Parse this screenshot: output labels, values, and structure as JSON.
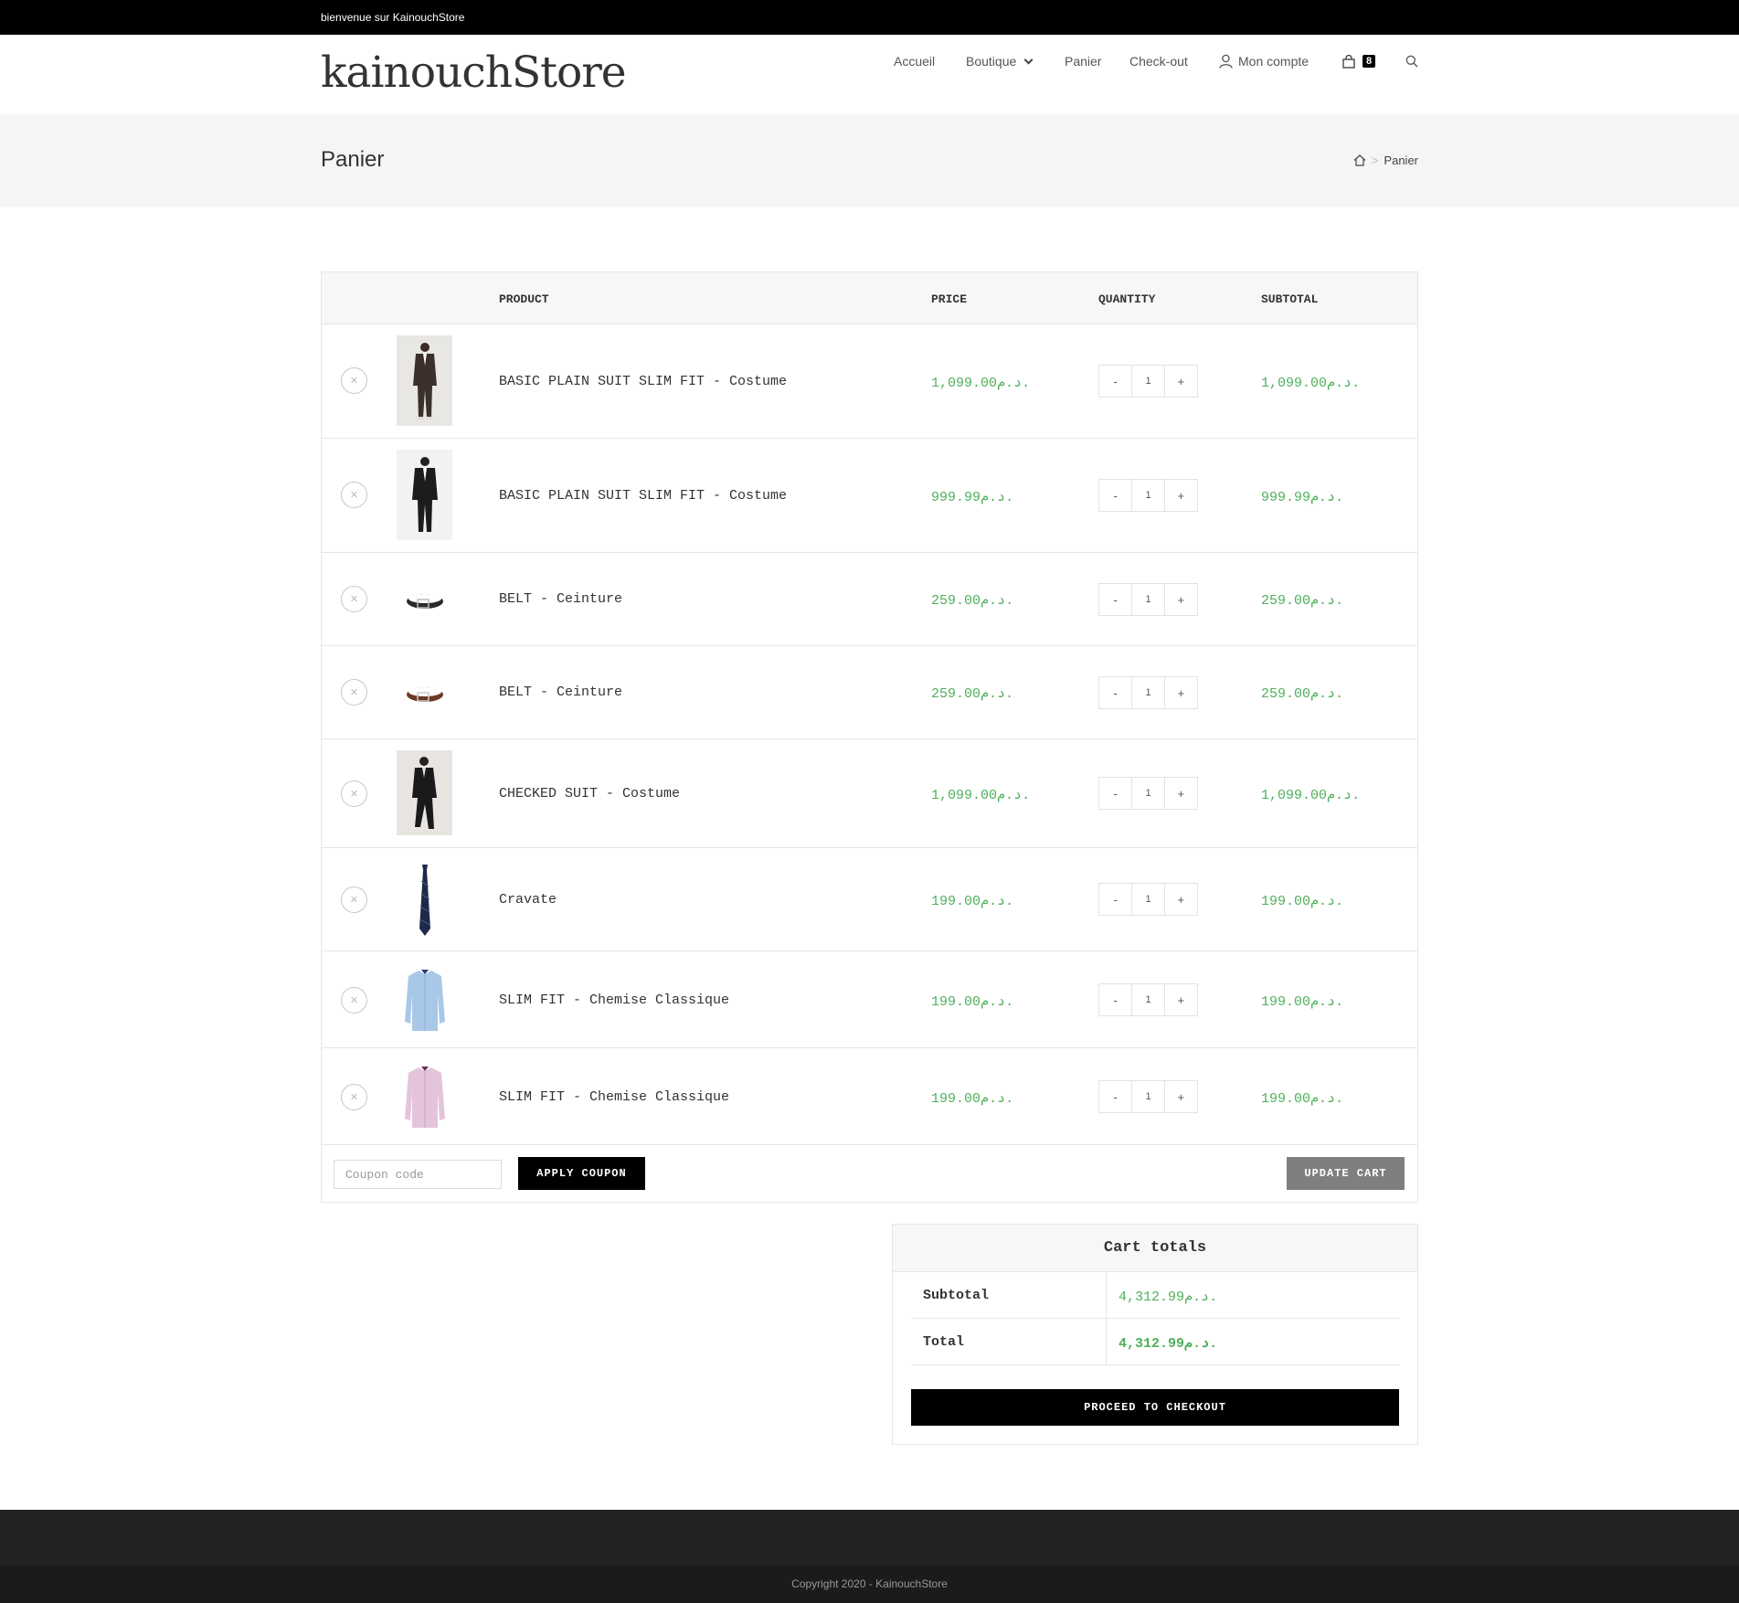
{
  "topbar": {
    "text": "bienvenue sur KainouchStore"
  },
  "header": {
    "logo": "kainouchStore",
    "nav": {
      "home": "Accueil",
      "shop": "Boutique",
      "cart": "Panier",
      "checkout": "Check-out",
      "account": "Mon compte",
      "cart_count": "8"
    }
  },
  "page": {
    "title": "Panier",
    "breadcrumb_current": "Panier"
  },
  "table": {
    "headers": {
      "product": "PRODUCT",
      "price": "PRICE",
      "quantity": "QUANTITY",
      "subtotal": "SUBTOTAL"
    },
    "rows": [
      {
        "name": "BASIC PLAIN SUIT SLIM FIT - Costume",
        "price": "1,099.00د.م.",
        "qty": "1",
        "subtotal": "1,099.00د.م.",
        "img": "suit-brown-icon"
      },
      {
        "name": "BASIC PLAIN SUIT SLIM FIT - Costume",
        "price": "999.99د.م.",
        "qty": "1",
        "subtotal": "999.99د.م.",
        "img": "suit-black-icon"
      },
      {
        "name": "BELT - Ceinture",
        "price": "259.00د.م.",
        "qty": "1",
        "subtotal": "259.00د.م.",
        "img": "belt-black-icon"
      },
      {
        "name": "BELT - Ceinture",
        "price": "259.00د.م.",
        "qty": "1",
        "subtotal": "259.00د.م.",
        "img": "belt-brown-icon"
      },
      {
        "name": "CHECKED SUIT - Costume",
        "price": "1,099.00د.م.",
        "qty": "1",
        "subtotal": "1,099.00د.م.",
        "img": "suit-checked-icon"
      },
      {
        "name": "Cravate",
        "price": "199.00د.م.",
        "qty": "1",
        "subtotal": "199.00د.م.",
        "img": "tie-icon"
      },
      {
        "name": "SLIM FIT - Chemise Classique",
        "price": "199.00د.م.",
        "qty": "1",
        "subtotal": "199.00د.م.",
        "img": "shirt-blue-icon"
      },
      {
        "name": "SLIM FIT - Chemise Classique",
        "price": "199.00د.م.",
        "qty": "1",
        "subtotal": "199.00د.م.",
        "img": "shirt-pink-icon"
      }
    ],
    "coupon_placeholder": "Coupon code",
    "apply_coupon": "APPLY COUPON",
    "update_cart": "UPDATE CART"
  },
  "totals": {
    "title": "Cart totals",
    "subtotal_label": "Subtotal",
    "subtotal_value": "4,312.99د.م.",
    "total_label": "Total",
    "total_value": "4,312.99د.م.",
    "checkout_button": "PROCEED TO CHECKOUT"
  },
  "footer": {
    "copyright": "Copyright 2020 - KainouchStore"
  },
  "colors": {
    "accent_price": "#4fb05b",
    "topbar": "#000000",
    "footer": "#222222"
  }
}
